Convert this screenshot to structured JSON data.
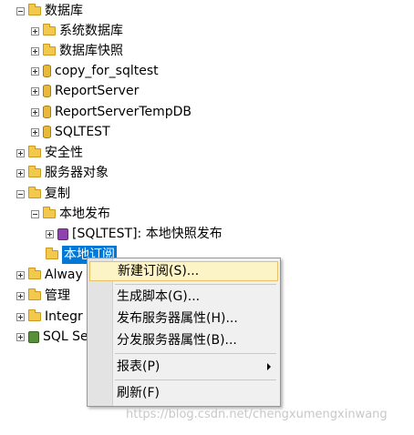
{
  "tree": {
    "databases": "数据库",
    "system_databases": "系统数据库",
    "db_snapshots": "数据库快照",
    "db_copy": "copy_for_sqltest",
    "db_reportserver": "ReportServer",
    "db_reportserver_temp": "ReportServerTempDB",
    "db_sqltest": "SQLTEST",
    "security": "安全性",
    "server_objects": "服务器对象",
    "replication": "复制",
    "local_publications": "本地发布",
    "publication_item": "[SQLTEST]: 本地快照发布",
    "local_subscriptions": "本地订阅",
    "alwayson": "Alway",
    "management": "管理",
    "integration": "Integr",
    "sql_agent": "SQL Se"
  },
  "context_menu": {
    "new_subscription": "新建订阅(S)...",
    "generate_script": "生成脚本(G)...",
    "publisher_props": "发布服务器属性(H)...",
    "distributor_props": "分发服务器属性(B)...",
    "reports": "报表(P)",
    "refresh": "刷新(F)"
  },
  "watermark": "https://blog.csdn.net/chengxumengxinwang",
  "colors": {
    "selection": "#0078d7",
    "menu_highlight": "#fcf4c7",
    "folder": "#f2c94c"
  }
}
